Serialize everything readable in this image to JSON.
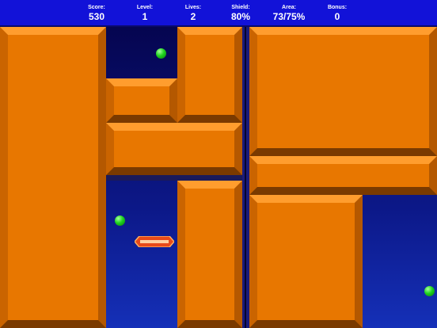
{
  "hud": {
    "score": {
      "label": "Score:",
      "value": "530"
    },
    "level": {
      "label": "Level:",
      "value": "1"
    },
    "lives": {
      "label": "Lives:",
      "value": "2"
    },
    "shield": {
      "label": "Shield:",
      "value": "80%"
    },
    "area": {
      "label": "Area:",
      "value": "73/75%"
    },
    "bonus": {
      "label": "Bonus:",
      "value": "0"
    }
  },
  "colors": {
    "hud_bar": "#1212d8",
    "block_face": "#e87700",
    "play_field": "#050550",
    "ball": "#1ed41e",
    "paddle": "#e84a1a"
  },
  "icons": [
    "green-ball",
    "paddle"
  ]
}
